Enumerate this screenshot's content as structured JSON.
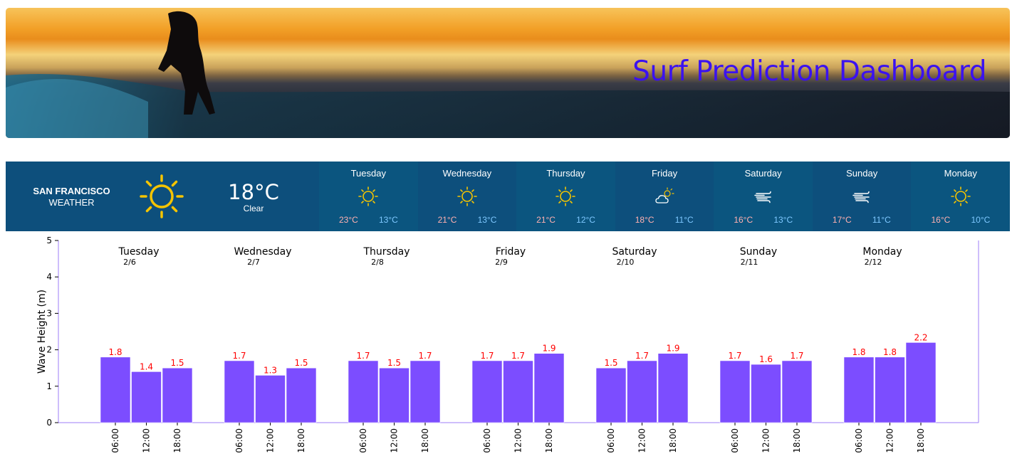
{
  "banner": {
    "title": "Surf Prediction Dashboard"
  },
  "weather": {
    "city": "SAN FRANCISCO",
    "label": "WEATHER",
    "current": {
      "temp": "18°C",
      "condition": "Clear",
      "icon": "sun-icon"
    },
    "forecast": [
      {
        "day": "Tuesday",
        "hi": "23°C",
        "lo": "13°C",
        "icon": "sun-icon"
      },
      {
        "day": "Wednesday",
        "hi": "21°C",
        "lo": "13°C",
        "icon": "sun-icon"
      },
      {
        "day": "Thursday",
        "hi": "21°C",
        "lo": "12°C",
        "icon": "sun-icon"
      },
      {
        "day": "Friday",
        "hi": "18°C",
        "lo": "11°C",
        "icon": "partly-cloudy-icon"
      },
      {
        "day": "Saturday",
        "hi": "16°C",
        "lo": "13°C",
        "icon": "wind-icon"
      },
      {
        "day": "Sunday",
        "hi": "17°C",
        "lo": "11°C",
        "icon": "wind-icon"
      },
      {
        "day": "Monday",
        "hi": "16°C",
        "lo": "10°C",
        "icon": "sun-icon"
      }
    ],
    "colors": {
      "background": "#0d4f7c",
      "hi": "#ffb0b0",
      "lo": "#7ec8ff"
    }
  },
  "chart_data": {
    "type": "bar",
    "ylabel": "Wave Height (m)",
    "xlabel": "",
    "ylim": [
      0,
      5
    ],
    "yticks": [
      0,
      1,
      2,
      3,
      4,
      5
    ],
    "bar_color": "#7c4dff",
    "label_color": "#ff0000",
    "groups": [
      {
        "day": "Tuesday",
        "date": "2/6",
        "times": [
          "06:00",
          "12:00",
          "18:00"
        ],
        "values": [
          1.8,
          1.4,
          1.5
        ],
        "labels": [
          "1.8",
          "1.4",
          "1.5"
        ]
      },
      {
        "day": "Wednesday",
        "date": "2/7",
        "times": [
          "06:00",
          "12:00",
          "18:00"
        ],
        "values": [
          1.7,
          1.3,
          1.5
        ],
        "labels": [
          "1.7",
          "1.3",
          "1.5"
        ]
      },
      {
        "day": "Thursday",
        "date": "2/8",
        "times": [
          "06:00",
          "12:00",
          "18:00"
        ],
        "values": [
          1.7,
          1.5,
          1.7
        ],
        "labels": [
          "1.7",
          "1.5",
          "1.7"
        ]
      },
      {
        "day": "Friday",
        "date": "2/9",
        "times": [
          "06:00",
          "12:00",
          "18:00"
        ],
        "values": [
          1.7,
          1.7,
          1.9
        ],
        "labels": [
          "1.7",
          "1.7",
          "1.9"
        ]
      },
      {
        "day": "Saturday",
        "date": "2/10",
        "times": [
          "06:00",
          "12:00",
          "18:00"
        ],
        "values": [
          1.5,
          1.7,
          1.9
        ],
        "labels": [
          "1.5",
          "1.7",
          "1.9"
        ]
      },
      {
        "day": "Sunday",
        "date": "2/11",
        "times": [
          "06:00",
          "12:00",
          "18:00"
        ],
        "values": [
          1.7,
          1.6,
          1.7
        ],
        "labels": [
          "1.7",
          "1.6",
          "1.7"
        ]
      },
      {
        "day": "Monday",
        "date": "2/12",
        "times": [
          "06:00",
          "12:00",
          "18:00"
        ],
        "values": [
          1.8,
          1.8,
          2.2
        ],
        "labels": [
          "1.8",
          "1.8",
          "2.2"
        ]
      }
    ]
  }
}
